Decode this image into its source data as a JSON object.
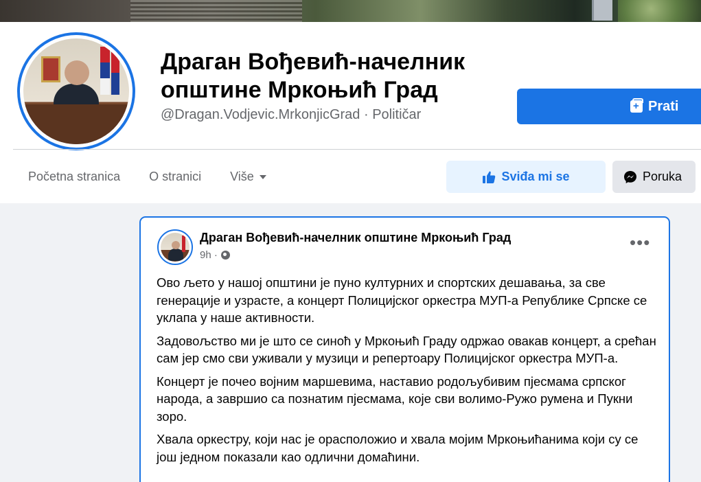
{
  "page": {
    "title": "Драган Вођевић-начелник општине Мркоњић Град",
    "handle": "@Dragan.Vodjevic.MrkonjicGrad · Političar"
  },
  "actions": {
    "follow_label": "Prati",
    "like_label": "Sviđa mi se",
    "message_label": "Poruka"
  },
  "nav": {
    "items": [
      "Početna stranica",
      "O stranici",
      "Više"
    ]
  },
  "post": {
    "author": "Драган Вођевић-начелник општине Мркоњић Град",
    "time": "9h ·",
    "paragraphs": [
      "Ово љето у нашој општини је пуно културних и спортских дешавања, за све генерације и узрасте, а концерт Полицијског оркестра МУП-а Републике Српске се уклапа у наше активности.",
      "Задовољство ми је што  се синоћ у Мркоњић Граду одржао овакав концерт, а срећан сам јер смо сви уживали у музици и репертоару Полицијског оркестра МУП-а.",
      "Концерт је почео војним маршевима, наставио родољубивим пјесмама српског народа, а завршио са познатим пјесмама, које сви волимо-Ружо румена и Пукни зоро.",
      "Хвала оркестру, који нас је  орасположио и хвала мојим Мркоњићанима који су се још једном показали као одлични домаћини."
    ]
  },
  "colors": {
    "accent": "#1b74e4",
    "like_bg": "#e7f3ff",
    "secondary_bg": "#e4e6eb",
    "muted_text": "#65676b",
    "page_bg": "#f0f2f5"
  },
  "icons": {
    "follow": "follow-page-icon",
    "like": "thumbs-up-icon",
    "message": "messenger-icon",
    "more": "more-dots-icon",
    "audience": "globe-icon",
    "dropdown": "caret-down-icon"
  }
}
